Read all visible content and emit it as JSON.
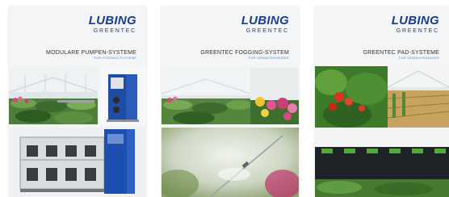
{
  "brochures": [
    {
      "logo_main": "LUBING",
      "logo_sub": "GREENTEC",
      "title": "MODULARE PUMPEN-SYSTEME",
      "subtitle": "FÜR FOGGING-SYSTEME"
    },
    {
      "logo_main": "LUBING",
      "logo_sub": "GREENTEC",
      "title": "GREENTEC FOGGING-SYSTEM",
      "subtitle": "FÜR GEWÄCHSHÄUSER"
    },
    {
      "logo_main": "LUBING",
      "logo_sub": "GREENTEC",
      "title": "GREENTEC PAD-SYSTEME",
      "subtitle": "FÜR GEWÄCHSHÄUSER"
    }
  ],
  "colors": {
    "brand_blue": "#173d91",
    "subtitle_blue": "#4a8bd0"
  }
}
